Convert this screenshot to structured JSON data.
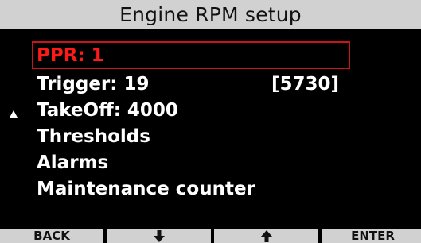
{
  "screen": {
    "title": "Engine RPM setup"
  },
  "menu": {
    "items": [
      {
        "label": "PPR: 1",
        "value": "",
        "selected": true
      },
      {
        "label": "Trigger: 19",
        "value": "[5730]",
        "selected": false
      },
      {
        "label": "TakeOff: 4000",
        "value": "",
        "selected": false
      },
      {
        "label": "Thresholds",
        "value": "",
        "selected": false
      },
      {
        "label": "Alarms",
        "value": "",
        "selected": false
      },
      {
        "label": "Maintenance counter",
        "value": "",
        "selected": false
      }
    ],
    "scroll_indicator_icon": "triangle-up-icon"
  },
  "softkeys": [
    {
      "label": "BACK",
      "icon": ""
    },
    {
      "label": "",
      "icon": "arrow-down-icon"
    },
    {
      "label": "",
      "icon": "arrow-up-icon"
    },
    {
      "label": "ENTER",
      "icon": ""
    }
  ],
  "colors": {
    "background": "#000000",
    "title_bar": "#d1d1d1",
    "selection": "#ff1a1a",
    "text": "#ffffff"
  }
}
